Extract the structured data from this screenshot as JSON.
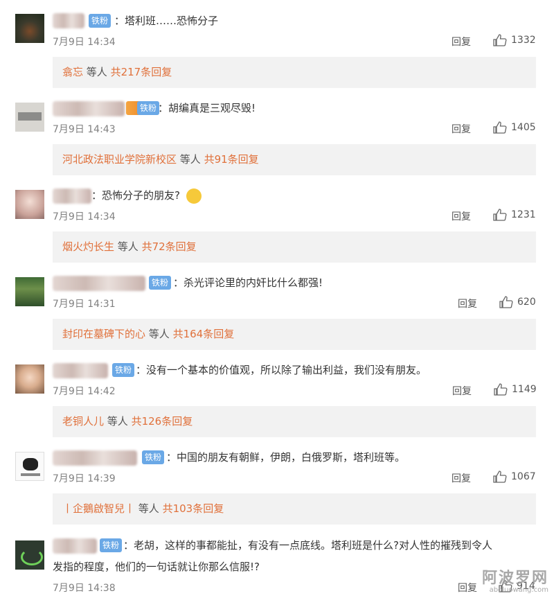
{
  "comments": [
    {
      "badge": "铁粉",
      "text": "塔利班……恐怖分子",
      "time": "7月9日 14:34",
      "reply": "回复",
      "likes": "1332",
      "reply_user": "翕忘",
      "reply_mid": "等人",
      "reply_count": "共217条回复"
    },
    {
      "badge": "铁粉",
      "text": "胡编真是三观尽毁!",
      "time": "7月9日 14:43",
      "reply": "回复",
      "likes": "1405",
      "reply_user": "河北政法职业学院新校区",
      "reply_mid": "等人",
      "reply_count": "共91条回复"
    },
    {
      "badge": "",
      "text": "恐怖分子的朋友?",
      "time": "7月9日 14:34",
      "reply": "回复",
      "likes": "1231",
      "reply_user": "烟火灼长生",
      "reply_mid": "等人",
      "reply_count": "共72条回复"
    },
    {
      "badge": "铁粉",
      "text": "杀光评论里的内奸比什么都强!",
      "time": "7月9日 14:31",
      "reply": "回复",
      "likes": "620",
      "reply_user": "封印在墓碑下的心",
      "reply_mid": "等人",
      "reply_count": "共164条回复"
    },
    {
      "badge": "铁粉",
      "text": "没有一个基本的价值观，所以除了输出利益，我们没有朋友。",
      "time": "7月9日 14:42",
      "reply": "回复",
      "likes": "1149",
      "reply_user": "老铜人儿",
      "reply_mid": "等人",
      "reply_count": "共126条回复"
    },
    {
      "badge": "铁粉",
      "text": "中国的朋友有朝鲜，伊朗，白俄罗斯，塔利班等。",
      "time": "7月9日 14:39",
      "reply": "回复",
      "likes": "1067",
      "reply_user": "丨企鵝啟智兒丨",
      "reply_mid": "等人",
      "reply_count": "共103条回复"
    },
    {
      "badge": "铁粉",
      "text_line1": "老胡，这样的事都能扯，有没有一点底线。塔利班是什么?对人性的摧残到令人",
      "text_line2": "发指的程度，他们的一句话就让你那么信服!?",
      "time": "7月9日 14:38",
      "reply": "回复",
      "likes": "914"
    }
  ],
  "watermark": {
    "big": "阿波罗网",
    "small": "aboluowang.com"
  },
  "icons": {
    "like": "thumbs-up-icon"
  },
  "colors": {
    "badge": "#6aa8e6",
    "link": "#e0703a",
    "reply_bg": "#f2f2f2"
  }
}
